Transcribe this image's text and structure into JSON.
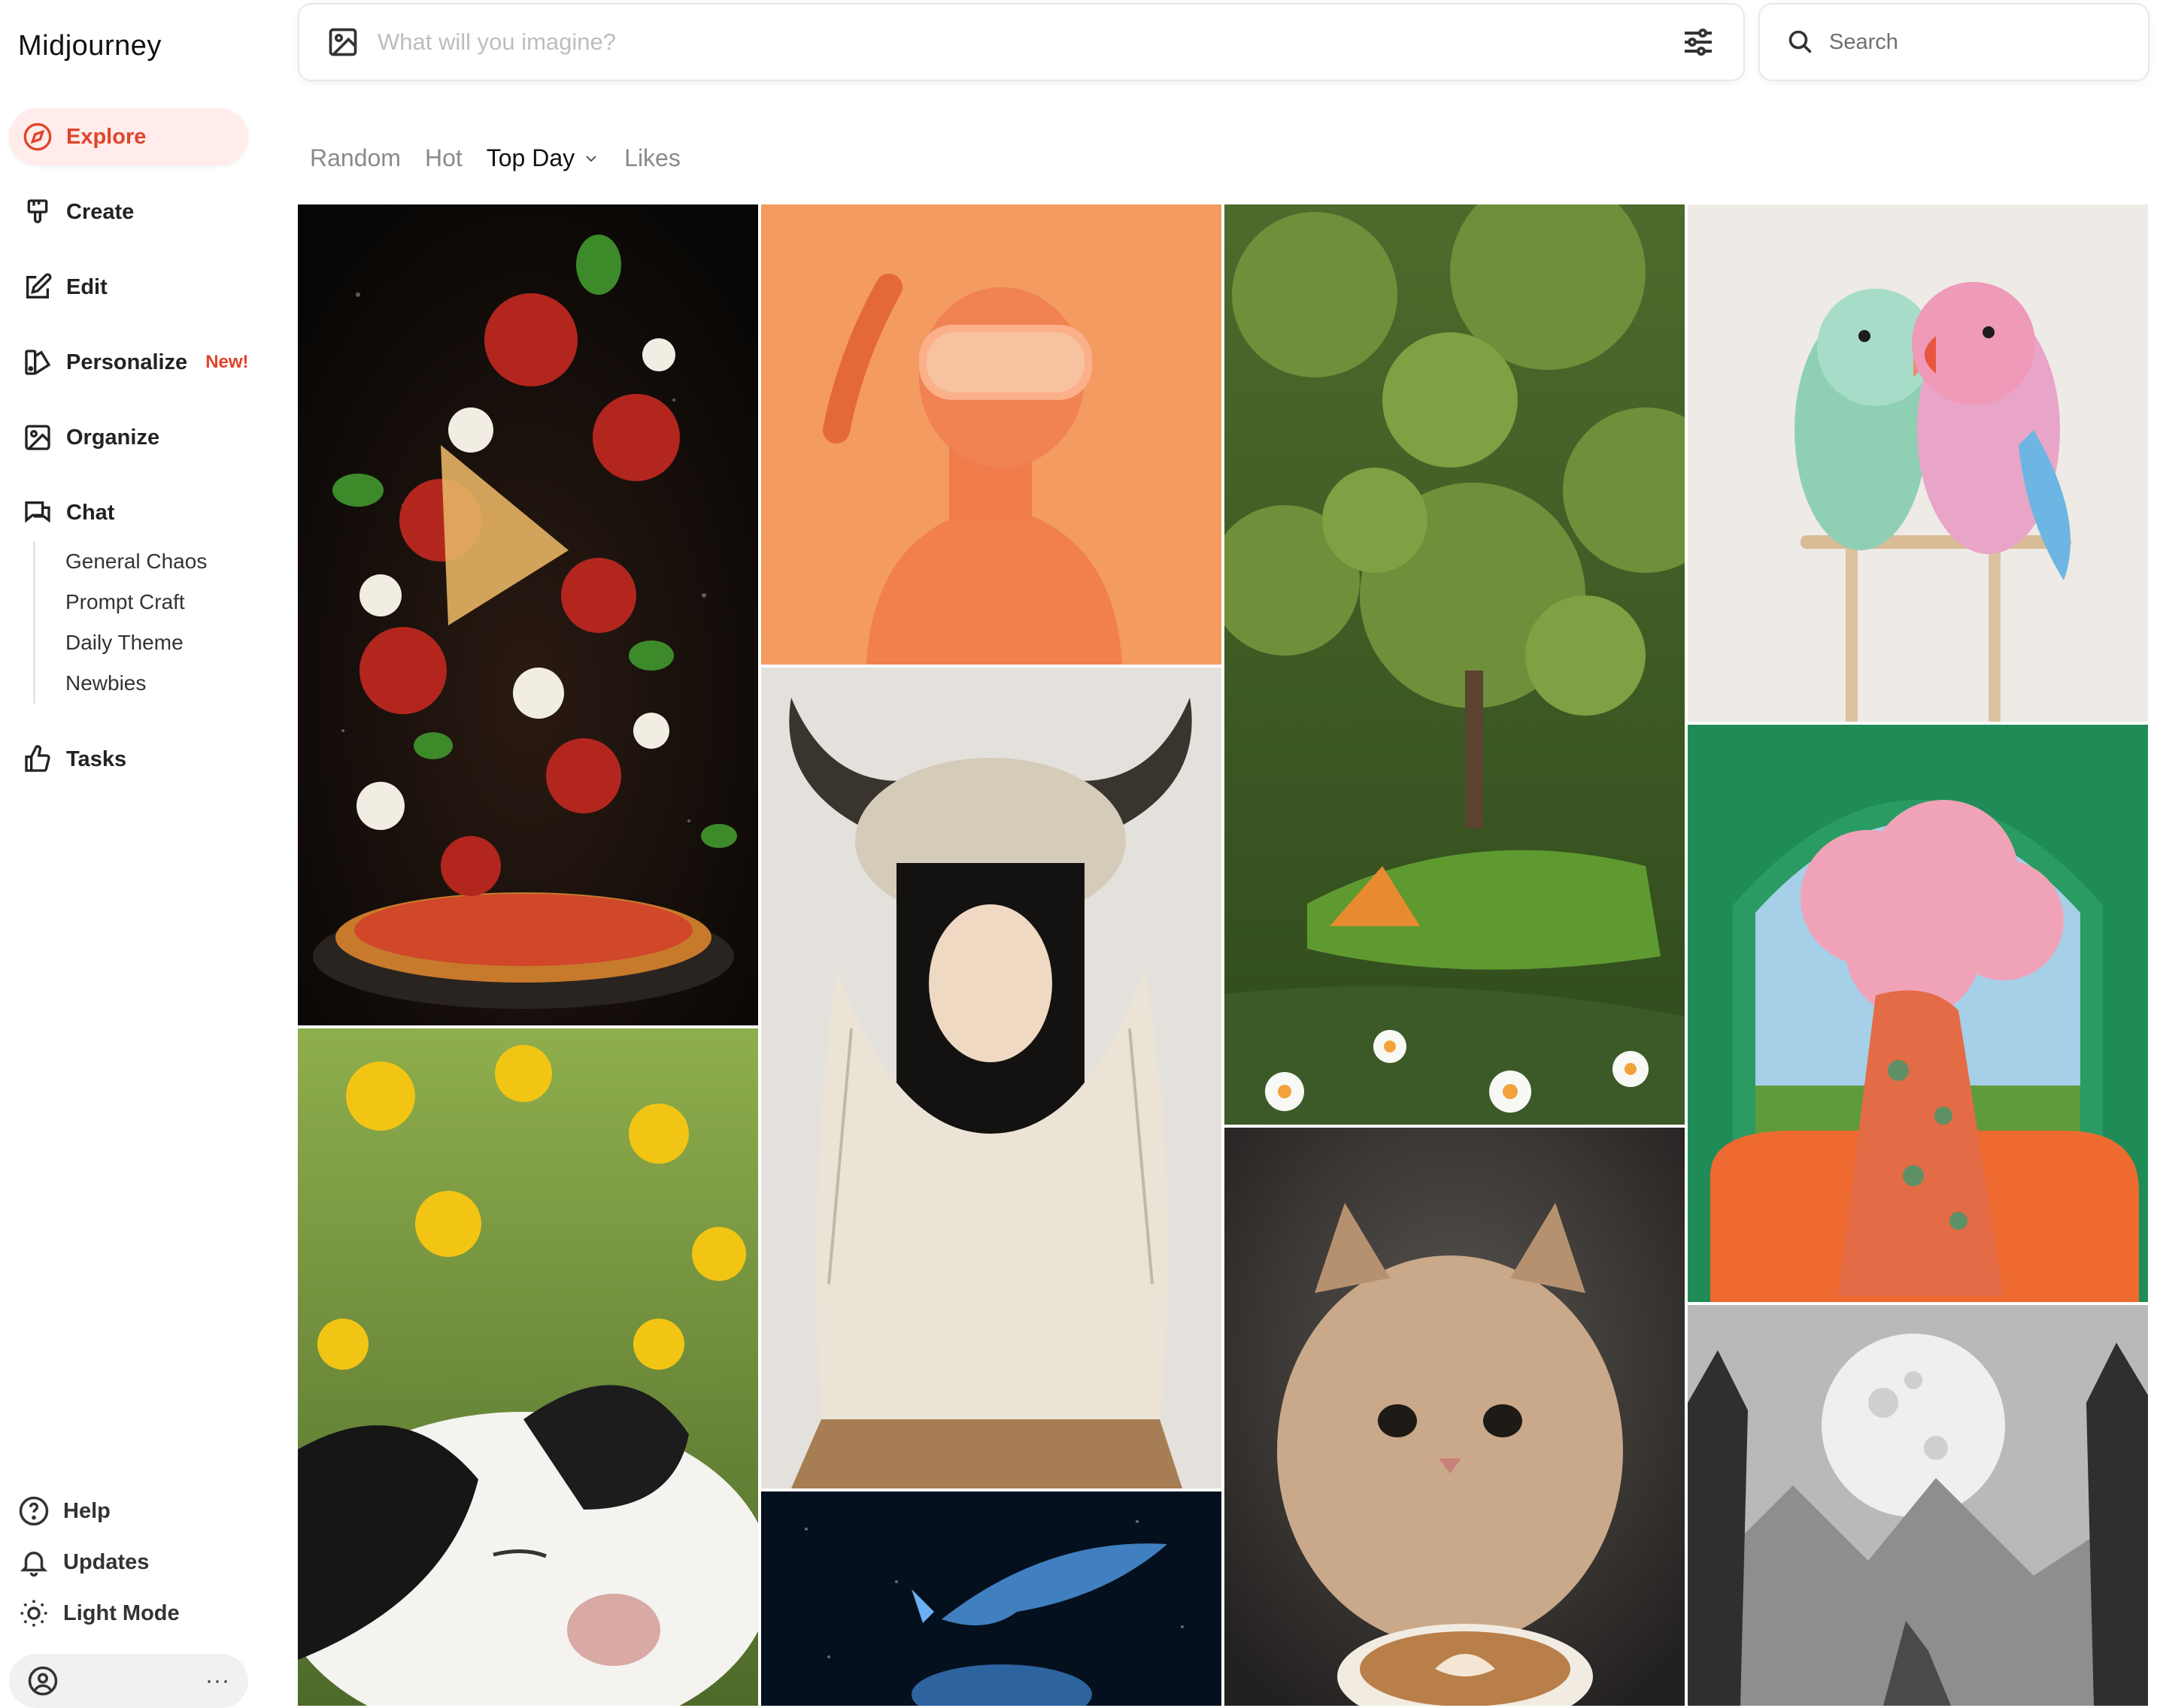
{
  "brand": "Midjourney",
  "nav": {
    "explore": "Explore",
    "create": "Create",
    "edit": "Edit",
    "personalize": "Personalize",
    "personalize_badge": "New!",
    "organize": "Organize",
    "chat": "Chat",
    "chat_channels": [
      "General Chaos",
      "Prompt Craft",
      "Daily Theme",
      "Newbies"
    ],
    "tasks": "Tasks"
  },
  "bottom": {
    "help": "Help",
    "updates": "Updates",
    "light_mode": "Light Mode",
    "more": "···"
  },
  "prompt": {
    "placeholder": "What will you imagine?"
  },
  "search": {
    "placeholder": "Search"
  },
  "tabs": {
    "random": "Random",
    "hot": "Hot",
    "top_day": "Top Day",
    "likes": "Likes",
    "active": "Top Day"
  },
  "gallery": {
    "images": [
      "pizza-explosion",
      "vr-headset-person",
      "miniature-forest-camp",
      "lovebirds-pair",
      "horned-headdress-girl",
      "pink-cloud-head-woman",
      "sleeping-goat",
      "fluffy-kitten-latte",
      "glowing-whales",
      "moon-wolf-sketch"
    ]
  },
  "colors": {
    "accent": "#e0442a",
    "active_bg": "#ffeceb"
  }
}
